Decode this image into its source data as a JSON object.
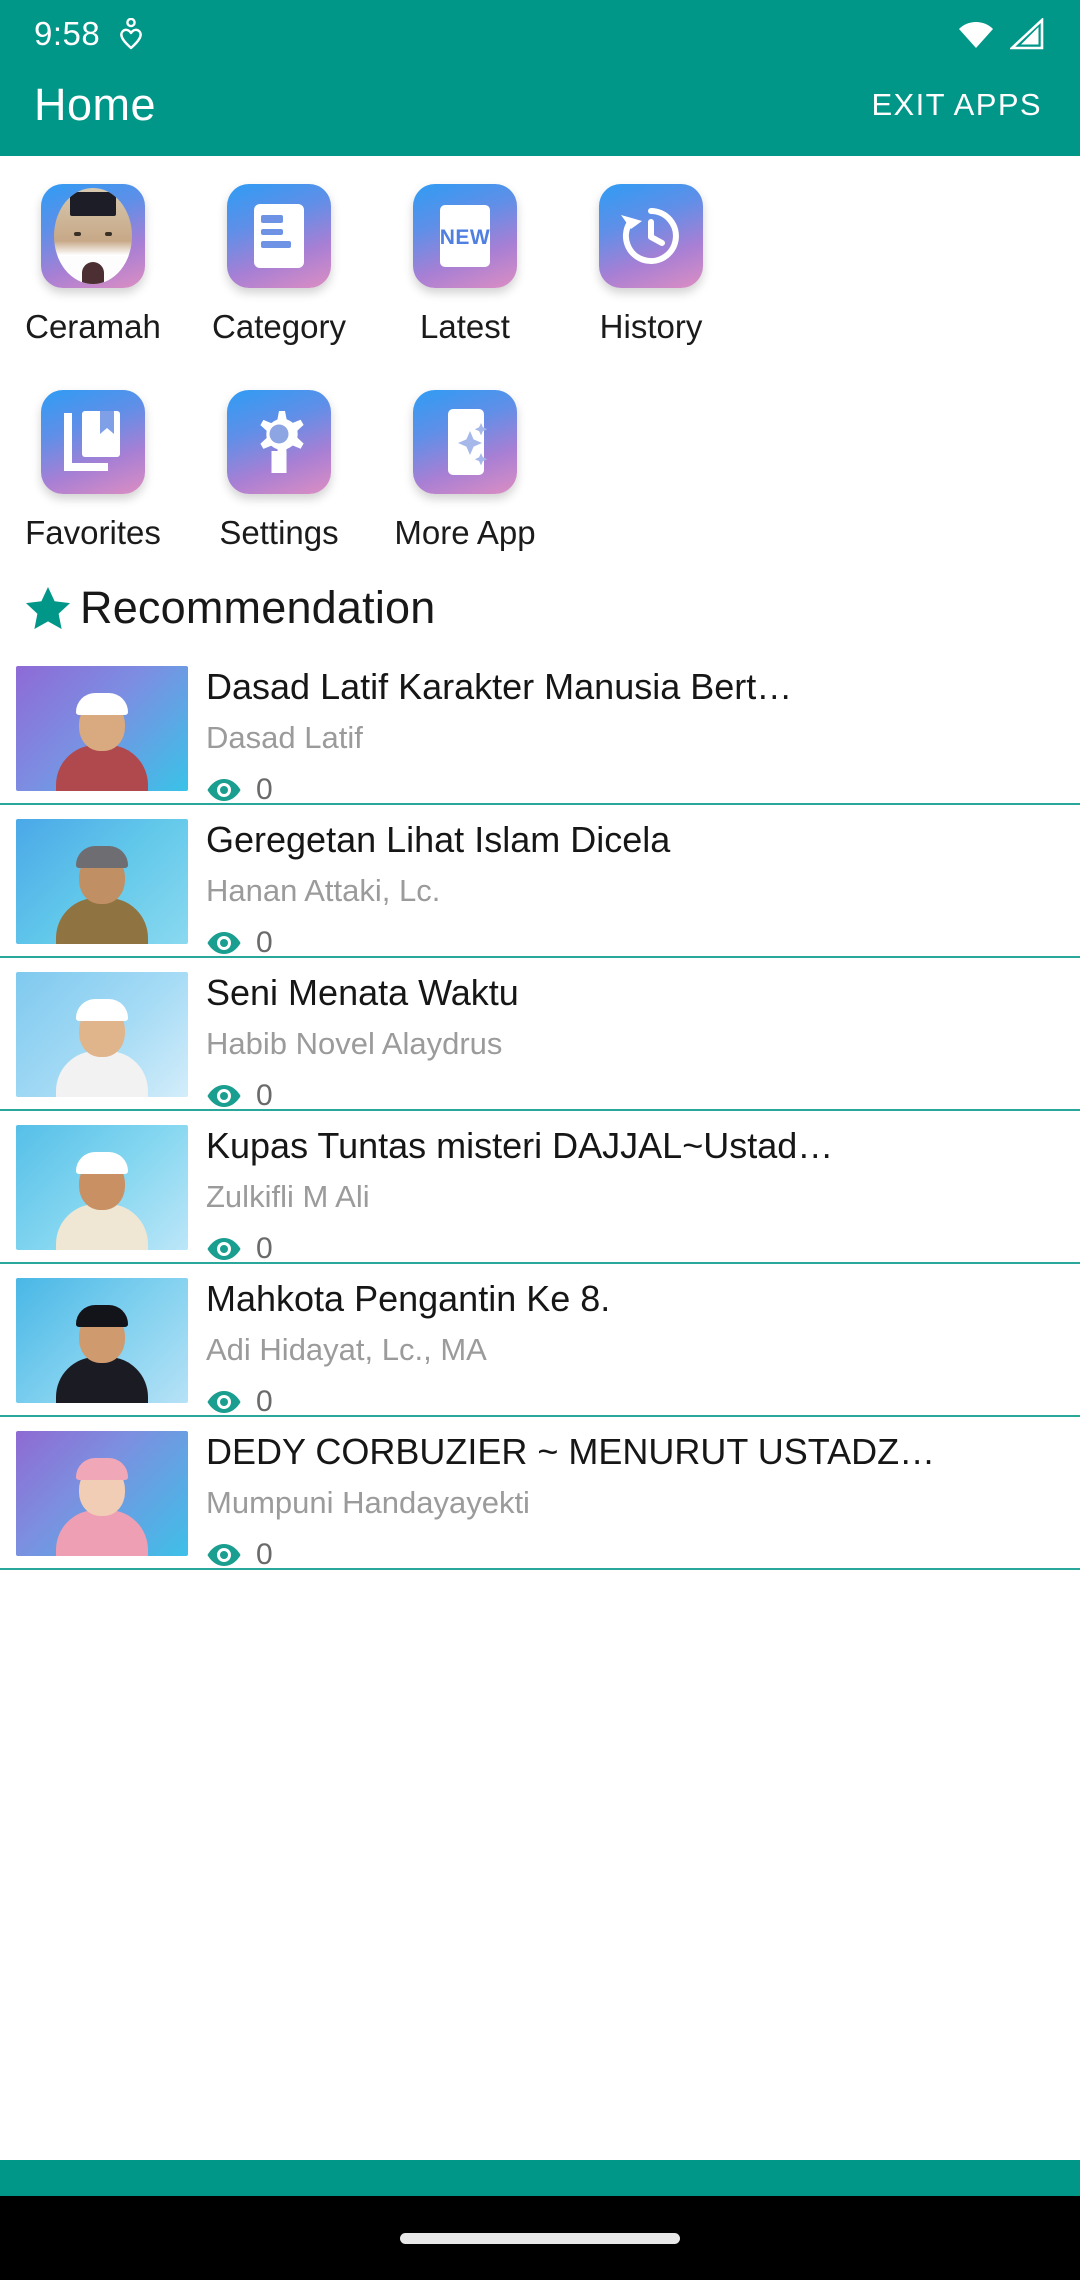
{
  "status_bar": {
    "time": "9:58",
    "icons": [
      "heart-pulse-icon",
      "wifi-icon",
      "cellular-signal-icon"
    ]
  },
  "app_bar": {
    "title": "Home",
    "exit_label": "EXIT APPS"
  },
  "theme": {
    "primary": "#009688",
    "accent": "#2aa79b",
    "tile_gradient_start": "#2f9cf4",
    "tile_gradient_end": "#dc8ec2",
    "title_text": "#161616",
    "subtitle_text": "#9b9b9b"
  },
  "shortcuts": {
    "row1": [
      {
        "label": "Ceramah",
        "icon": "preacher-avatar-icon"
      },
      {
        "label": "Category",
        "icon": "article-list-icon"
      },
      {
        "label": "Latest",
        "icon": "new-badge-icon",
        "badge_text": "NEW"
      },
      {
        "label": "History",
        "icon": "history-clock-icon"
      }
    ],
    "row2": [
      {
        "label": "Favorites",
        "icon": "bookmark-library-icon"
      },
      {
        "label": "Settings",
        "icon": "gear-icon"
      },
      {
        "label": "More App",
        "icon": "phone-sparkle-icon"
      }
    ]
  },
  "section": {
    "icon": "star-icon",
    "title": "Recommendation"
  },
  "recommendations": [
    {
      "title": "Dasad Latif   Karakter Manusia Bert…",
      "speaker": "Dasad Latif",
      "views": "0",
      "views_icon": "eye-icon",
      "thumb": {
        "skin": "#d9a97f",
        "cap": "#ffffff",
        "body": "#b0494d",
        "bg_a": "#8e6ad6",
        "bg_b": "#39c3e8"
      }
    },
    {
      "title": "Geregetan Lihat Islam Dicela",
      "speaker": "Hanan Attaki, Lc.",
      "views": "0",
      "views_icon": "eye-icon",
      "thumb": {
        "skin": "#c08f63",
        "cap": "#6d6d72",
        "body": "#8f7340",
        "bg_a": "#4aa8e8",
        "bg_b": "#6fd4ee"
      }
    },
    {
      "title": "Seni Menata Waktu",
      "speaker": "Habib Novel Alaydrus",
      "views": "0",
      "views_icon": "eye-icon",
      "thumb": {
        "skin": "#e0b58b",
        "cap": "#ffffff",
        "body": "#f2f2f2",
        "bg_a": "#7fc9ef",
        "bg_b": "#bfe6f7"
      }
    },
    {
      "title": "Kupas Tuntas misteri DAJJAL~Ustad…",
      "speaker": "Zulkifli M Ali",
      "views": "0",
      "views_icon": "eye-icon",
      "thumb": {
        "skin": "#c99163",
        "cap": "#ffffff",
        "body": "#efe6d4",
        "bg_a": "#56bfe8",
        "bg_b": "#9fdff3"
      }
    },
    {
      "title": "Mahkota Pengantin Ke 8.",
      "speaker": "Adi Hidayat, Lc., MA",
      "views": "0",
      "views_icon": "eye-icon",
      "thumb": {
        "skin": "#cf9a6d",
        "cap": "#13131a",
        "body": "#1b1b24",
        "bg_a": "#49b7e6",
        "bg_b": "#a8e0f4"
      }
    },
    {
      "title": "DEDY CORBUZIER ~ MENURUT USTADZ…",
      "speaker": "Mumpuni Handayayekti",
      "views": "0",
      "views_icon": "eye-icon",
      "thumb": {
        "skin": "#f0cdb4",
        "cap": "#f0a8b8",
        "body": "#ef9fb4",
        "bg_a": "#8f6ad2",
        "bg_b": "#3ec0e8"
      }
    }
  ],
  "navigation_bar": {
    "gesture_pill": "home-gesture-pill"
  }
}
